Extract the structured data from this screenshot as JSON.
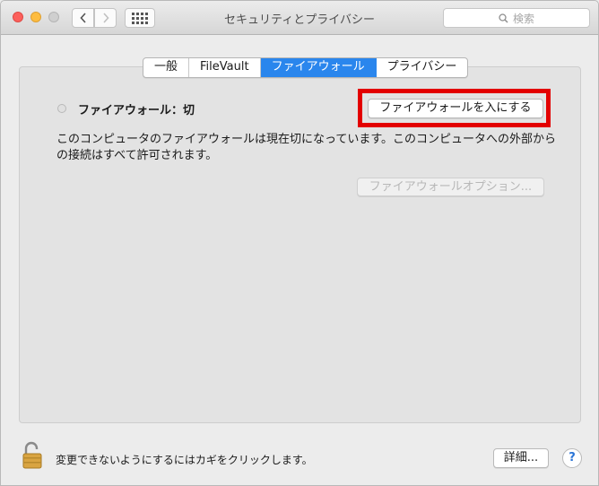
{
  "window": {
    "title": "セキュリティとプライバシー",
    "search_placeholder": "検索"
  },
  "tabs": [
    {
      "label": "一般",
      "active": false
    },
    {
      "label": "FileVault",
      "active": false
    },
    {
      "label": "ファイアウォール",
      "active": true
    },
    {
      "label": "プライバシー",
      "active": false
    }
  ],
  "firewall": {
    "status_label": "ファイアウォール：切",
    "turn_on_button": "ファイアウォールを入にする",
    "description": "このコンピュータのファイアウォールは現在切になっています。このコンピュータへの外部からの接続はすべて許可されます。",
    "options_button": "ファイアウォールオプション..."
  },
  "footer": {
    "lock_text": "変更できないようにするにはカギをクリックします。",
    "advanced_button": "詳細...",
    "help_button": "?"
  },
  "colors": {
    "accent": "#2a86ed",
    "highlight": "#e30000"
  }
}
